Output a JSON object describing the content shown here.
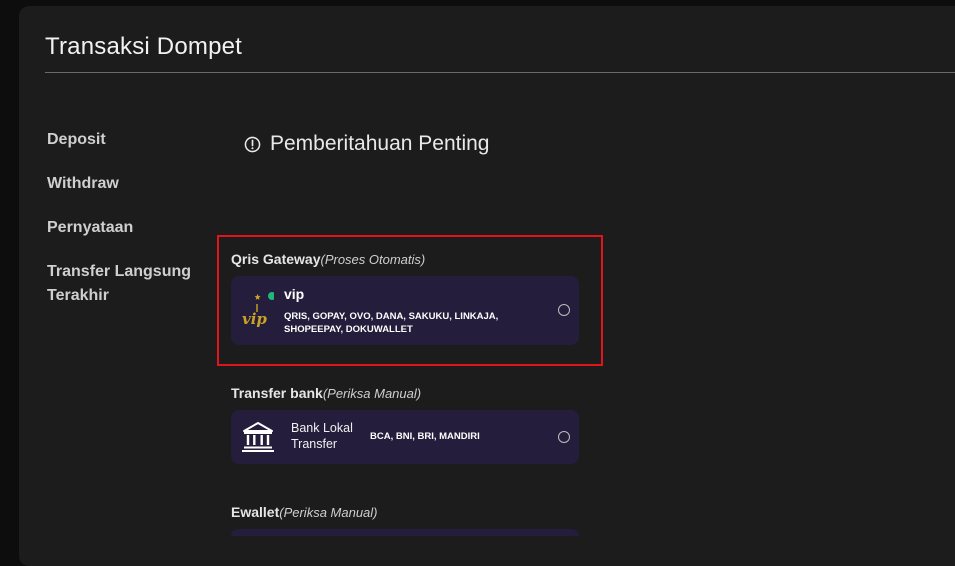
{
  "header": {
    "title": "Transaksi Dompet"
  },
  "sidebar": {
    "items": [
      {
        "label": "Deposit"
      },
      {
        "label": "Withdraw"
      },
      {
        "label": "Pernyataan"
      },
      {
        "label": "Transfer Langsung Terakhir"
      }
    ]
  },
  "notice": {
    "text": "Pemberitahuan Penting",
    "icon": "alert-circle-icon"
  },
  "sections": {
    "qris": {
      "title": "Qris Gateway",
      "subtitle": "(Proses Otomatis)",
      "option": {
        "name": "vip",
        "methods": "QRIS, GOPAY, OVO, DANA, SAKUKU, LINKAJA, SHOPEEPAY, DOKUWALLET",
        "logo_text": "VIP",
        "status_color": "#1fb87a"
      }
    },
    "bank": {
      "title": "Transfer bank",
      "subtitle": "(Periksa Manual)",
      "option": {
        "name": "Bank Lokal Transfer",
        "banks": "BCA, BNI, BRI, MANDIRI",
        "icon": "bank-icon"
      }
    },
    "ewallet": {
      "title": "Ewallet",
      "subtitle": "(Periksa Manual)"
    }
  },
  "colors": {
    "panel": "#1c1c1c",
    "card": "#241d3b",
    "highlight": "#e0141b",
    "gold": "#c9a227"
  }
}
